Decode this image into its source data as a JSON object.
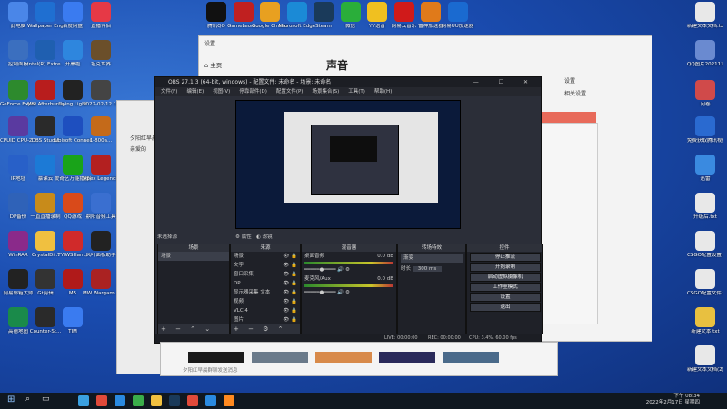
{
  "desktop": {
    "left_icons": [
      {
        "label": "此电脑",
        "color": "#4a86e8"
      },
      {
        "label": "Wallpaper Engine：...",
        "color": "#1f6fd1"
      },
      {
        "label": "百度网盘",
        "color": "#3a7bf0"
      },
      {
        "label": "直播伴侣",
        "color": "#e63946"
      },
      {
        "label": "控制面板",
        "color": "#3b6fbf"
      },
      {
        "label": "Intel(R) Extre...",
        "color": "#1f5fb0"
      },
      {
        "label": "开黑啦",
        "color": "#2e86de"
      },
      {
        "label": "坦克世界",
        "color": "#6b4f2a"
      },
      {
        "label": "GeForce Experience",
        "color": "#2d8a2d"
      },
      {
        "label": "MSI Afterburner",
        "color": "#b81d1d"
      },
      {
        "label": "Dying Light",
        "color": "#222222"
      },
      {
        "label": "2022-02-12 17-46-50...",
        "color": "#444444"
      },
      {
        "label": "CPUID CPU-Z MSI",
        "color": "#5a3aa0"
      },
      {
        "label": "OBS Studio",
        "color": "#2a2a2a"
      },
      {
        "label": "Ubisoft Connect",
        "color": "#1e4fbf"
      },
      {
        "label": "1-800a...",
        "color": "#c46a1a"
      },
      {
        "label": "IP地址",
        "color": "#2860c8"
      },
      {
        "label": "慕课云",
        "color": "#1c7ad6"
      },
      {
        "label": "爱奇艺万能播放器",
        "color": "#19a319"
      },
      {
        "label": "Apex Legends",
        "color": "#b32020"
      },
      {
        "label": "DP备份",
        "color": "#2f62b8"
      },
      {
        "label": "一直直播录制",
        "color": "#c88b1a"
      },
      {
        "label": "QQ游戏",
        "color": "#d94a1a"
      },
      {
        "label": "鼎阳音频工具",
        "color": "#3a6fd0"
      },
      {
        "label": "WinRAR",
        "color": "#8a2a8a"
      },
      {
        "label": "CrystalDi...",
        "color": "#f0c040"
      },
      {
        "label": "TYIWSHan...",
        "color": "#d02a2a"
      },
      {
        "label": "风叶面板助手",
        "color": "#222222"
      },
      {
        "label": "网易邮箱大师",
        "color": "#222222"
      },
      {
        "label": "Gt剪辑",
        "color": "#333333"
      },
      {
        "label": "M5",
        "color": "#b01a1a"
      },
      {
        "label": "MW Wargam...",
        "color": "#aa2222"
      },
      {
        "label": "高德地图",
        "color": "#1a8a4a"
      },
      {
        "label": "Counter-St...",
        "color": "#2a2a2a"
      },
      {
        "label": "TIM",
        "color": "#3a7bf0"
      }
    ],
    "top_icons": [
      {
        "label": "腾讯QQ",
        "color": "#111111"
      },
      {
        "label": "GameLeon...",
        "color": "#c02020"
      },
      {
        "label": "Google Chrome",
        "color": "#e8a020"
      },
      {
        "label": "Microsoft Edge",
        "color": "#1b8ad6"
      },
      {
        "label": "Steam",
        "color": "#1a3a5a"
      },
      {
        "label": "微信",
        "color": "#2aae3a"
      },
      {
        "label": "YY语音",
        "color": "#f0c020"
      },
      {
        "label": "网易云音乐",
        "color": "#d01a1a"
      },
      {
        "label": "雷神加速器",
        "color": "#e07a1a"
      },
      {
        "label": "网易UU加速器",
        "color": "#1a6ad0"
      }
    ],
    "right_icons": [
      {
        "label": "新建文本文档.txt",
        "color": "#e8e8e8"
      },
      {
        "label": "QQ图片20211102...",
        "color": "#6a8ad0"
      },
      {
        "label": "问卷",
        "color": "#d04a4a"
      },
      {
        "label": "免费获取腾讯视频",
        "color": "#2a6ad0"
      },
      {
        "label": "迅雷",
        "color": "#3a8ae0"
      },
      {
        "label": "升级后.txt",
        "color": "#e8e8e8"
      },
      {
        "label": "CSGO配置设置.cfg",
        "color": "#e8e8e8"
      },
      {
        "label": "CSGO配置文件.txt",
        "color": "#e8e8e8"
      },
      {
        "label": "新建文本.txt",
        "color": "#e8c040"
      },
      {
        "label": "新建文本文档(2).txt",
        "color": "#e8e8e8"
      }
    ]
  },
  "settings_window": {
    "title": "设置",
    "home": "主页",
    "page_title": "声音",
    "right_text_1": "设置",
    "right_text_2": "相关设置"
  },
  "chat_window": {
    "tab_1": "夕阳红早晨",
    "tab_2": "亲爱的",
    "input_placeholder": "夕阳红早晨群聊发送消息"
  },
  "obs": {
    "title": "OBS 27.1.3 (64-bit, windows) - 配置文件: 未命名 - 场景: 未命名",
    "menu": [
      "文件(F)",
      "编辑(E)",
      "视图(V)",
      "停靠部件(D)",
      "配置文件(P)",
      "场景集合(S)",
      "工具(T)",
      "帮助(H)"
    ],
    "no_source": "未选择源",
    "props_btn": "属性",
    "filter_btn": "滤镜",
    "docks": {
      "scenes": {
        "title": "场景",
        "items": [
          "场景"
        ]
      },
      "sources": {
        "title": "来源",
        "items": [
          "场景",
          "文字",
          "窗口采集",
          "DP",
          "显示器采集 文本",
          "视频",
          "VLC 4",
          "图片",
          "视频采集"
        ]
      },
      "mixer": {
        "title": "混音器",
        "channels": [
          {
            "name": "桌面音频",
            "level": "0.0 dB"
          },
          {
            "name": "麦克风/Aux",
            "level": "0.0 dB"
          }
        ]
      },
      "transitions": {
        "title": "转场特效",
        "type": "渐变",
        "duration_label": "时长",
        "duration": "300 ms"
      },
      "controls": {
        "title": "控件",
        "buttons": [
          "停止推流",
          "开始录制",
          "启动虚拟摄像机",
          "工作室模式",
          "设置",
          "退出"
        ]
      }
    },
    "status": {
      "live": "LIVE: 00:00:00",
      "rec": "REC: 00:00:00",
      "cpu": "CPU: 3.4%, 60.00 fps"
    }
  },
  "taskbar": {
    "time": "下午 08:34",
    "date": "2022年2月17日 星期四",
    "icon_colors": [
      "#3aa0e0",
      "#e04a3a",
      "#2a8ae0",
      "#3aae4a",
      "#f0c040",
      "#1a3a5a",
      "#e04a3a",
      "#2a8ae0",
      "#ff8a20"
    ]
  }
}
